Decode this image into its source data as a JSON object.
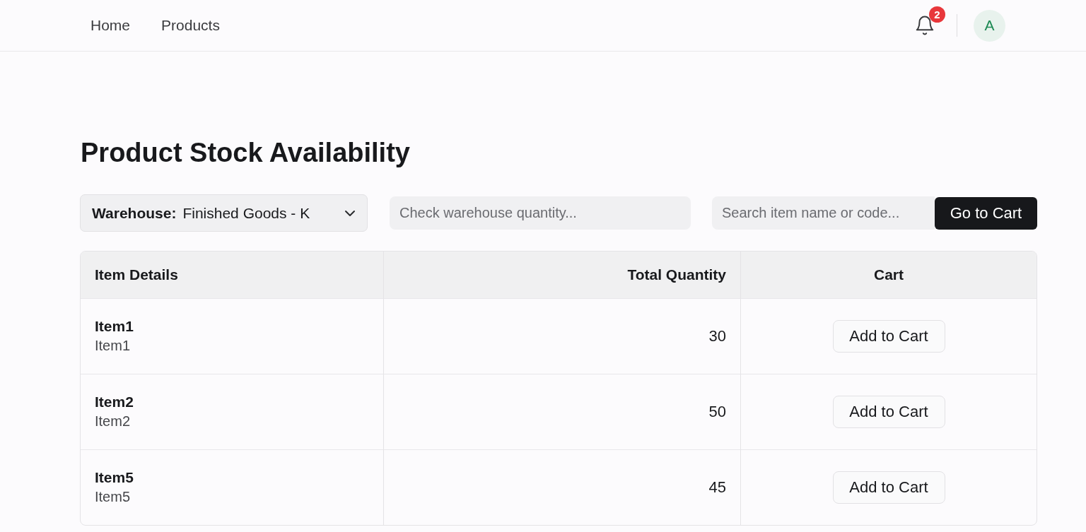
{
  "nav": {
    "links": [
      {
        "label": "Home"
      },
      {
        "label": "Products"
      }
    ],
    "notifications": {
      "count": "2"
    },
    "avatar": {
      "initial": "A"
    }
  },
  "page": {
    "title": "Product Stock Availability"
  },
  "filters": {
    "warehouse": {
      "label": "Warehouse:",
      "value": "Finished Goods - K"
    },
    "quantity_search": {
      "placeholder": "Check warehouse quantity..."
    },
    "item_search": {
      "placeholder": "Search item name or code..."
    },
    "cart_button": "Go to Cart"
  },
  "table": {
    "columns": [
      {
        "label": "Item Details"
      },
      {
        "label": "Total Quantity"
      },
      {
        "label": "Cart"
      }
    ],
    "rows": [
      {
        "name": "Item1",
        "code": "Item1",
        "quantity": "30",
        "action": "Add to Cart"
      },
      {
        "name": "Item2",
        "code": "Item2",
        "quantity": "50",
        "action": "Add to Cart"
      },
      {
        "name": "Item5",
        "code": "Item5",
        "quantity": "45",
        "action": "Add to Cart"
      }
    ]
  }
}
